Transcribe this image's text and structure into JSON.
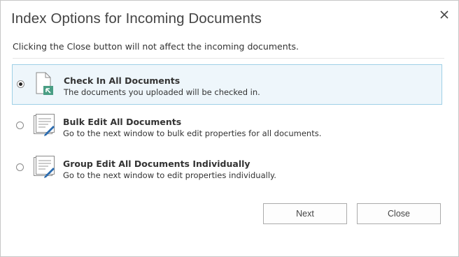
{
  "dialog": {
    "title": "Index Options for Incoming Documents",
    "subtitle": "Clicking the Close button will not affect the incoming documents.",
    "close_icon": "close-x-icon"
  },
  "options": [
    {
      "title": "Check In All Documents",
      "description": "The documents you uploaded will be checked in.",
      "icon": "document-checkin-icon",
      "selected": true
    },
    {
      "title": "Bulk Edit All Documents",
      "description": "Go to the next window to bulk edit properties for all documents.",
      "icon": "bulk-edit-icon",
      "selected": false
    },
    {
      "title": "Group Edit All Documents Individually",
      "description": "Go to the next window to edit properties individually.",
      "icon": "group-edit-icon",
      "selected": false
    }
  ],
  "buttons": {
    "next": "Next",
    "close": "Close"
  },
  "colors": {
    "selected_background": "#eef6fb",
    "selected_border": "#9fd0e6",
    "accent_green": "#3f9a7e",
    "pencil_blue": "#2b6cb0"
  }
}
